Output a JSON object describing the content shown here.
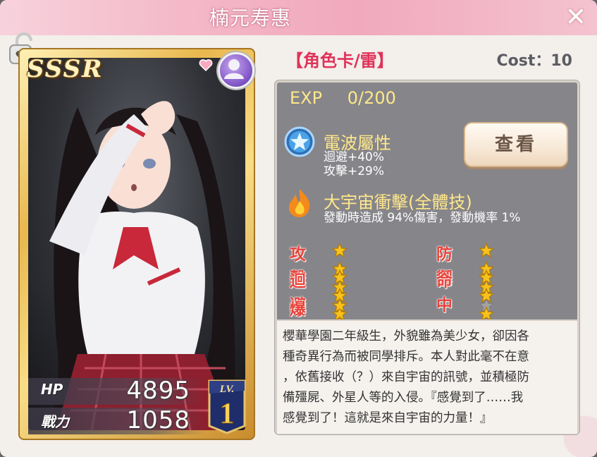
{
  "header": {
    "title": "楠元寿惠",
    "close_icon": "close-icon"
  },
  "card": {
    "rarity": "SSSR",
    "hp_label": "HP",
    "hp_value": "4895",
    "power_label": "戰力",
    "power_value": "1058",
    "level_label": "LV.",
    "level_value": "1"
  },
  "info": {
    "category": "【角色卡/雷】",
    "cost": "Cost：10",
    "exp_label": "EXP",
    "exp_value": "0/200",
    "skill1": {
      "icon": "star-orb-icon",
      "name": "電波屬性",
      "line1": "迴避+40%",
      "line2": "攻擊+29%"
    },
    "view_button": "查看",
    "skill2": {
      "icon": "flame-icon",
      "name": "大宇宙衝擊(全體技)",
      "line1": "發動時造成 94%傷害，發動機率 1%"
    },
    "attributes": [
      {
        "label": "攻擊",
        "stars": 4,
        "max": 5
      },
      {
        "label": "防禦",
        "stars": 3,
        "max": 5
      },
      {
        "label": "迴避",
        "stars": 5,
        "max": 5
      },
      {
        "label": "命中",
        "stars": 4,
        "max": 5
      },
      {
        "label": "爆擊",
        "stars": 4,
        "max": 5
      }
    ],
    "description": [
      "櫻華學園二年級生，外貌雖為美少女，卻因各",
      "種奇異行為而被同學排斥。本人對此毫不在意",
      "，依舊接收（？）來自宇宙的訊號，並積極防",
      "備殭屍、外星人等的入侵。『感覺到了……我",
      "感覺到了！這就是來自宇宙的力量！』"
    ]
  },
  "colors": {
    "title_pink": "#f1a9bd",
    "star_gold": "#f6c21b",
    "star_empty": "#a3a3a3",
    "attr_red": "#e8433a",
    "category_red": "#e0325a"
  }
}
